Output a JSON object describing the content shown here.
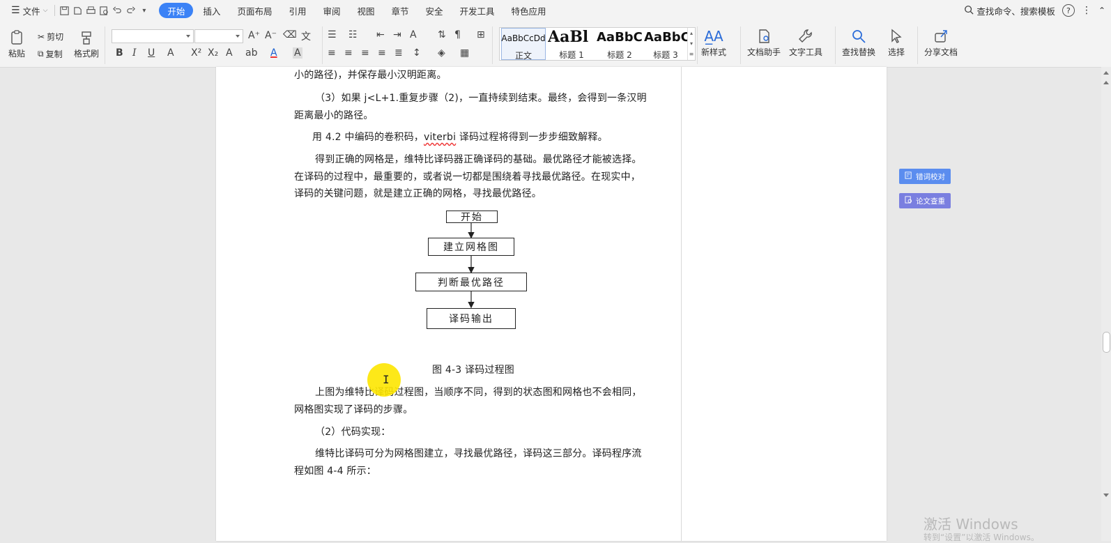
{
  "menubar": {
    "file_label": "文件",
    "tabs": [
      "开始",
      "插入",
      "页面布局",
      "引用",
      "审阅",
      "视图",
      "章节",
      "安全",
      "开发工具",
      "特色应用"
    ],
    "active_tab": "开始",
    "search_label": "查找命令、搜索模板"
  },
  "ribbon": {
    "paste": "粘贴",
    "cut": "剪切",
    "copy": "复制",
    "format_painter": "格式刷",
    "styles": [
      {
        "preview": "AaBbCcDd",
        "name": "正文"
      },
      {
        "preview": "AaBl",
        "name": "标题 1"
      },
      {
        "preview": "AaBbC",
        "name": "标题 2"
      },
      {
        "preview": "AaBbC",
        "name": "标题 3"
      }
    ],
    "new_style": "新样式",
    "doc_helper": "文档助手",
    "text_tools": "文字工具",
    "find_replace": "查找替换",
    "select": "选择",
    "share_doc": "分享文档"
  },
  "document": {
    "line1": "小的路径)，并保存最小汉明距离。",
    "para3_line1": "（3）如果 j<L+1.重复步骤（2)，一直持续到结束。最终，会得到一条汉明",
    "para3_line2": "距离最小的路径。",
    "para_use_pre": "用 4.2 中编码的卷积码，",
    "para_use_viterbi": "viterbi",
    "para_use_post": " 译码过程将得到一步步细致解释。",
    "para_grid_line1": "得到正确的网格是，维特比译码器正确译码的基础。最优路径才能被选择。",
    "para_grid_line2": "在译码的过程中，最重要的，或者说一切都是围绕着寻找最优路径。在现实中，",
    "para_grid_line3": "译码的关键问题，就是建立正确的网格，寻找最优路径。",
    "flowchart": [
      "开始",
      "建立网格图",
      "判断最优路径",
      "译码输出"
    ],
    "figure_caption": "图 4-3  译码过程图",
    "para_above_line1": "上图为维特比译码过程图，当顺序不同，得到的状态图和网格也不会相同，",
    "para_above_line2": "网格图实现了译码的步骤。",
    "para_code": "（2）代码实现：",
    "para_viterbi_line1": "维特比译码可分为网格图建立，寻找最优路径，译码这三部分。译码程序流",
    "para_viterbi_line2": "程如图 4-4 所示："
  },
  "side_panel": {
    "spell_check": "错词校对",
    "thesis_check": "论文查重",
    "accent": "#5b8def",
    "accent2": "#7a7fe0"
  },
  "watermark": {
    "line1": "激活 Windows",
    "line2": "转到“设置”以激活 Windows。"
  }
}
